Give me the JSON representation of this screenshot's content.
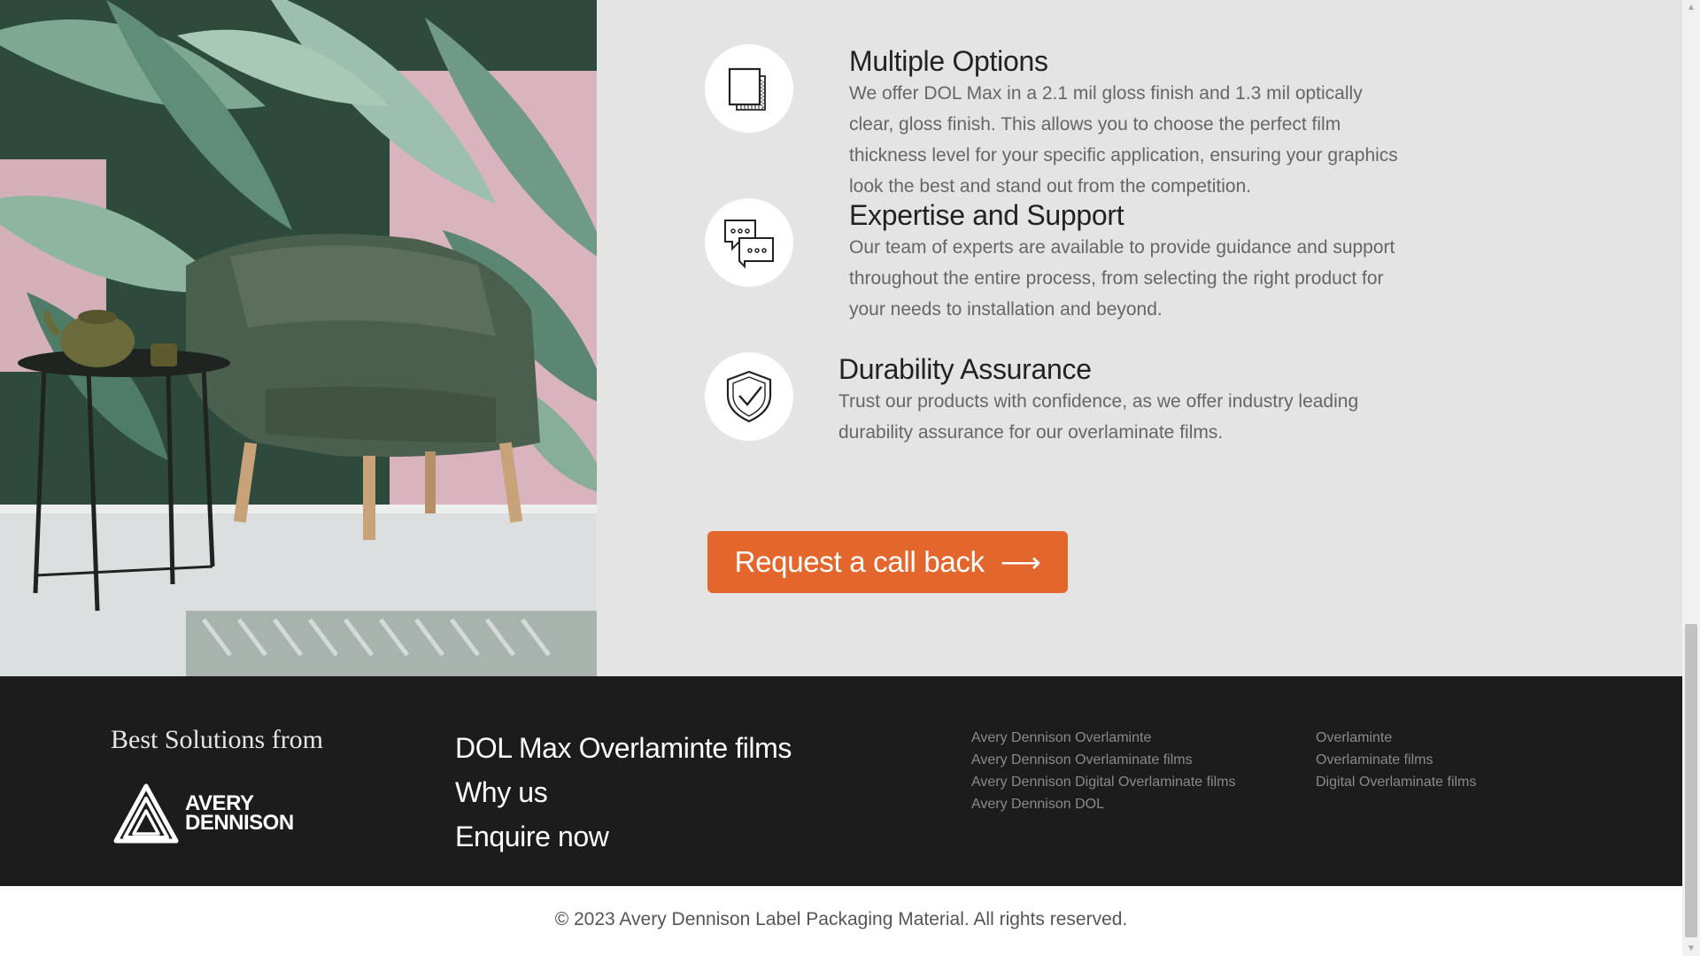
{
  "features": [
    {
      "title": "Multiple Options",
      "body": "We offer DOL Max in a 2.1 mil gloss finish and 1.3 mil optically clear, gloss finish. This allows you to choose the perfect film thickness level for your specific application, ensuring your graphics look the best and stand out from the competition.",
      "icon": "layers-icon"
    },
    {
      "title": "Expertise and Support",
      "body": "Our team of experts are available to provide guidance and support throughout the entire process, from selecting the right product for your needs to installation and beyond.",
      "icon": "chat-bubbles-icon"
    },
    {
      "title": "Durability Assurance",
      "body": "Trust our products with confidence, as we offer industry leading durability assurance for our overlaminate films.",
      "icon": "shield-check-icon"
    }
  ],
  "cta": {
    "label": "Request a call back",
    "arrow": "⟶",
    "color": "#e3672c"
  },
  "footer": {
    "tagline": "Best Solutions from",
    "logo_text": [
      "AVERY",
      "DENNISON"
    ],
    "nav": [
      "DOL Max Overlaminte films",
      "Why us",
      "Enquire now"
    ],
    "keywords_col1": [
      "Avery Dennison Overlaminte",
      "Avery Dennison Overlaminate films",
      "Avery Dennison Digital Overlaminate films",
      "Avery Dennison DOL"
    ],
    "keywords_col2": [
      "Overlaminte",
      "Overlaminate films",
      "Digital Overlaminate films"
    ]
  },
  "copyright": "© 2023 Avery Dennison Label Packaging Material. All rights reserved.",
  "colors": {
    "section_bg": "#e4e4e4",
    "footer_bg": "#1c1c1c",
    "accent": "#e3672c"
  }
}
